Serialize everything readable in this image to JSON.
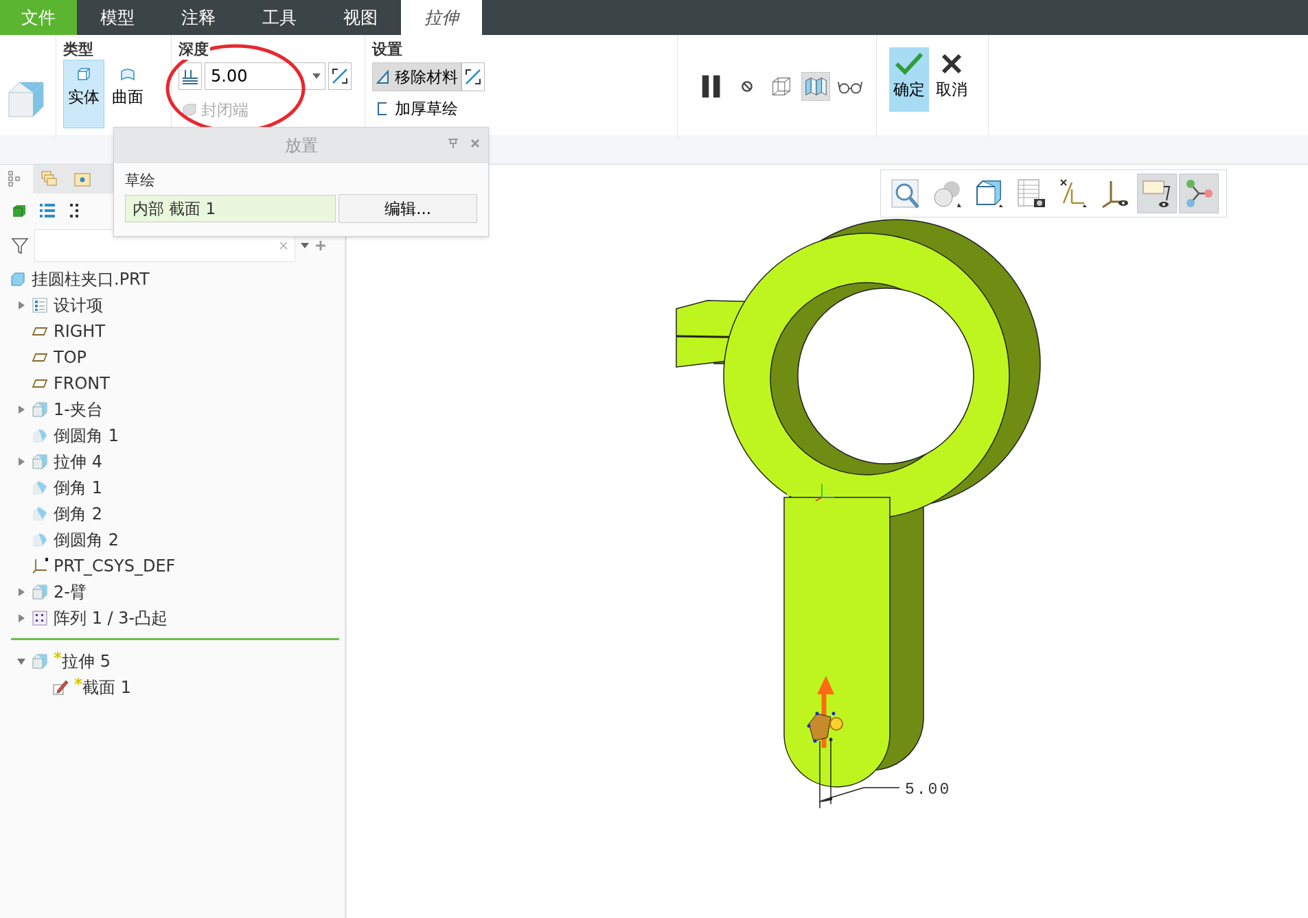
{
  "menu_tabs": [
    {
      "label": "文件",
      "kind": "file",
      "selected": false
    },
    {
      "label": "模型",
      "kind": "tab",
      "selected": false
    },
    {
      "label": "注释",
      "kind": "tab",
      "selected": false
    },
    {
      "label": "工具",
      "kind": "tab",
      "selected": false
    },
    {
      "label": "视图",
      "kind": "tab",
      "selected": false
    },
    {
      "label": "拉伸",
      "kind": "contextual",
      "selected": true
    }
  ],
  "ribbon": {
    "type_group": {
      "title": "类型",
      "options": [
        {
          "label": "实体",
          "kind": "solid",
          "selected": true
        },
        {
          "label": "曲面",
          "kind": "surface",
          "selected": false
        }
      ]
    },
    "depth_group": {
      "title": "深度",
      "value": "5.00",
      "cap_ends": {
        "label": "封闭端",
        "disabled": true
      }
    },
    "settings_group": {
      "title": "设置",
      "options": [
        {
          "label": "移除材料",
          "kind": "remove",
          "selected": true
        },
        {
          "label": "加厚草绘",
          "kind": "thicken",
          "selected": false
        }
      ]
    },
    "preview_tools": [
      {
        "kind": "pause",
        "selected": false
      },
      {
        "kind": "no-sign",
        "selected": false
      },
      {
        "kind": "wireframe",
        "selected": false
      },
      {
        "kind": "preview",
        "selected": true
      },
      {
        "kind": "glasses",
        "selected": false
      }
    ],
    "confirm": "确定",
    "cancel": "取消"
  },
  "placement_panel": {
    "title": "放置",
    "sketch_label": "草绘",
    "sketch_value": "内部 截面 1",
    "edit_button": "编辑..."
  },
  "panel_tabs": [
    {
      "kind": "tree",
      "selected": true
    },
    {
      "kind": "layers",
      "selected": false
    },
    {
      "kind": "folder",
      "selected": false
    }
  ],
  "model_tree": {
    "root": "挂圆柱夹口.PRT",
    "items": [
      {
        "label": "设计项",
        "kind": "design",
        "expanded": false
      },
      {
        "label": "RIGHT",
        "kind": "plane"
      },
      {
        "label": "TOP",
        "kind": "plane"
      },
      {
        "label": "FRONT",
        "kind": "plane"
      },
      {
        "label": "1-夹台",
        "kind": "extrude",
        "expanded": false
      },
      {
        "label": "倒圆角 1",
        "kind": "round"
      },
      {
        "label": "拉伸 4",
        "kind": "extrude",
        "expanded": false
      },
      {
        "label": "倒角 1",
        "kind": "chamfer"
      },
      {
        "label": "倒角 2",
        "kind": "chamfer"
      },
      {
        "label": "倒圆角 2",
        "kind": "round"
      },
      {
        "label": "PRT_CSYS_DEF",
        "kind": "csys"
      },
      {
        "label": "2-臂",
        "kind": "extrude",
        "expanded": false
      },
      {
        "label": "阵列 1 / 3-凸起",
        "kind": "pattern",
        "expanded": false
      }
    ],
    "inserted": [
      {
        "label": "拉伸 5",
        "kind": "extrude",
        "new": true,
        "expanded": true,
        "children": [
          {
            "label": "截面 1",
            "kind": "sketch",
            "new": true
          }
        ]
      }
    ]
  },
  "view_toolbar": [
    {
      "kind": "zoom",
      "selected": false
    },
    {
      "kind": "shading",
      "selected": false
    },
    {
      "kind": "view-cube",
      "selected": false
    },
    {
      "kind": "table",
      "selected": false
    },
    {
      "kind": "datum",
      "selected": false
    },
    {
      "kind": "csys",
      "selected": false
    },
    {
      "kind": "annotation",
      "selected": true
    },
    {
      "kind": "network",
      "selected": true
    }
  ],
  "dimension": {
    "value": "5.00"
  }
}
